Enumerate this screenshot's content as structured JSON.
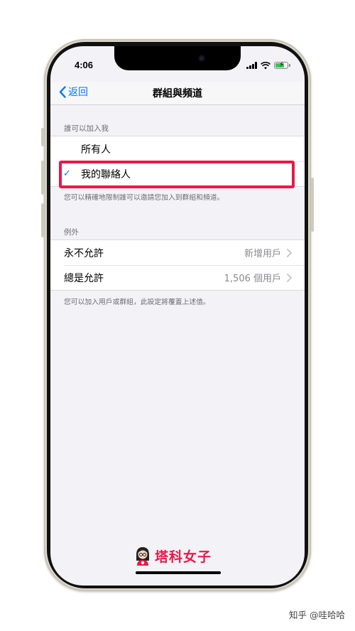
{
  "status_bar": {
    "time": "4:06"
  },
  "nav": {
    "back_label": "返回",
    "title": "群組與頻道"
  },
  "who_can_add": {
    "header": "誰可以加入我",
    "options": [
      {
        "label": "所有人",
        "checked": false
      },
      {
        "label": "我的聯絡人",
        "checked": true
      }
    ],
    "check_glyph": "✓",
    "note": "您可以精確地限制誰可以邀請您加入到群組和頻道。"
  },
  "exceptions": {
    "header": "例外",
    "rows": [
      {
        "label": "永不允許",
        "value": "新增用戶"
      },
      {
        "label": "總是允許",
        "value": "1,506 個用戶"
      }
    ],
    "note": "您可以加入用戶或群組，此設定將覆蓋上述值。"
  },
  "watermark": {
    "logo_text": "塔科女子",
    "site_mark": "知乎 @哇哈哈"
  },
  "colors": {
    "accent": "#007aff",
    "highlight": "#e8194a",
    "background": "#f2f2f7"
  },
  "icons": {
    "back": "chevron-left-icon",
    "disclosure": "chevron-right-icon",
    "battery": "battery-charging-icon"
  }
}
